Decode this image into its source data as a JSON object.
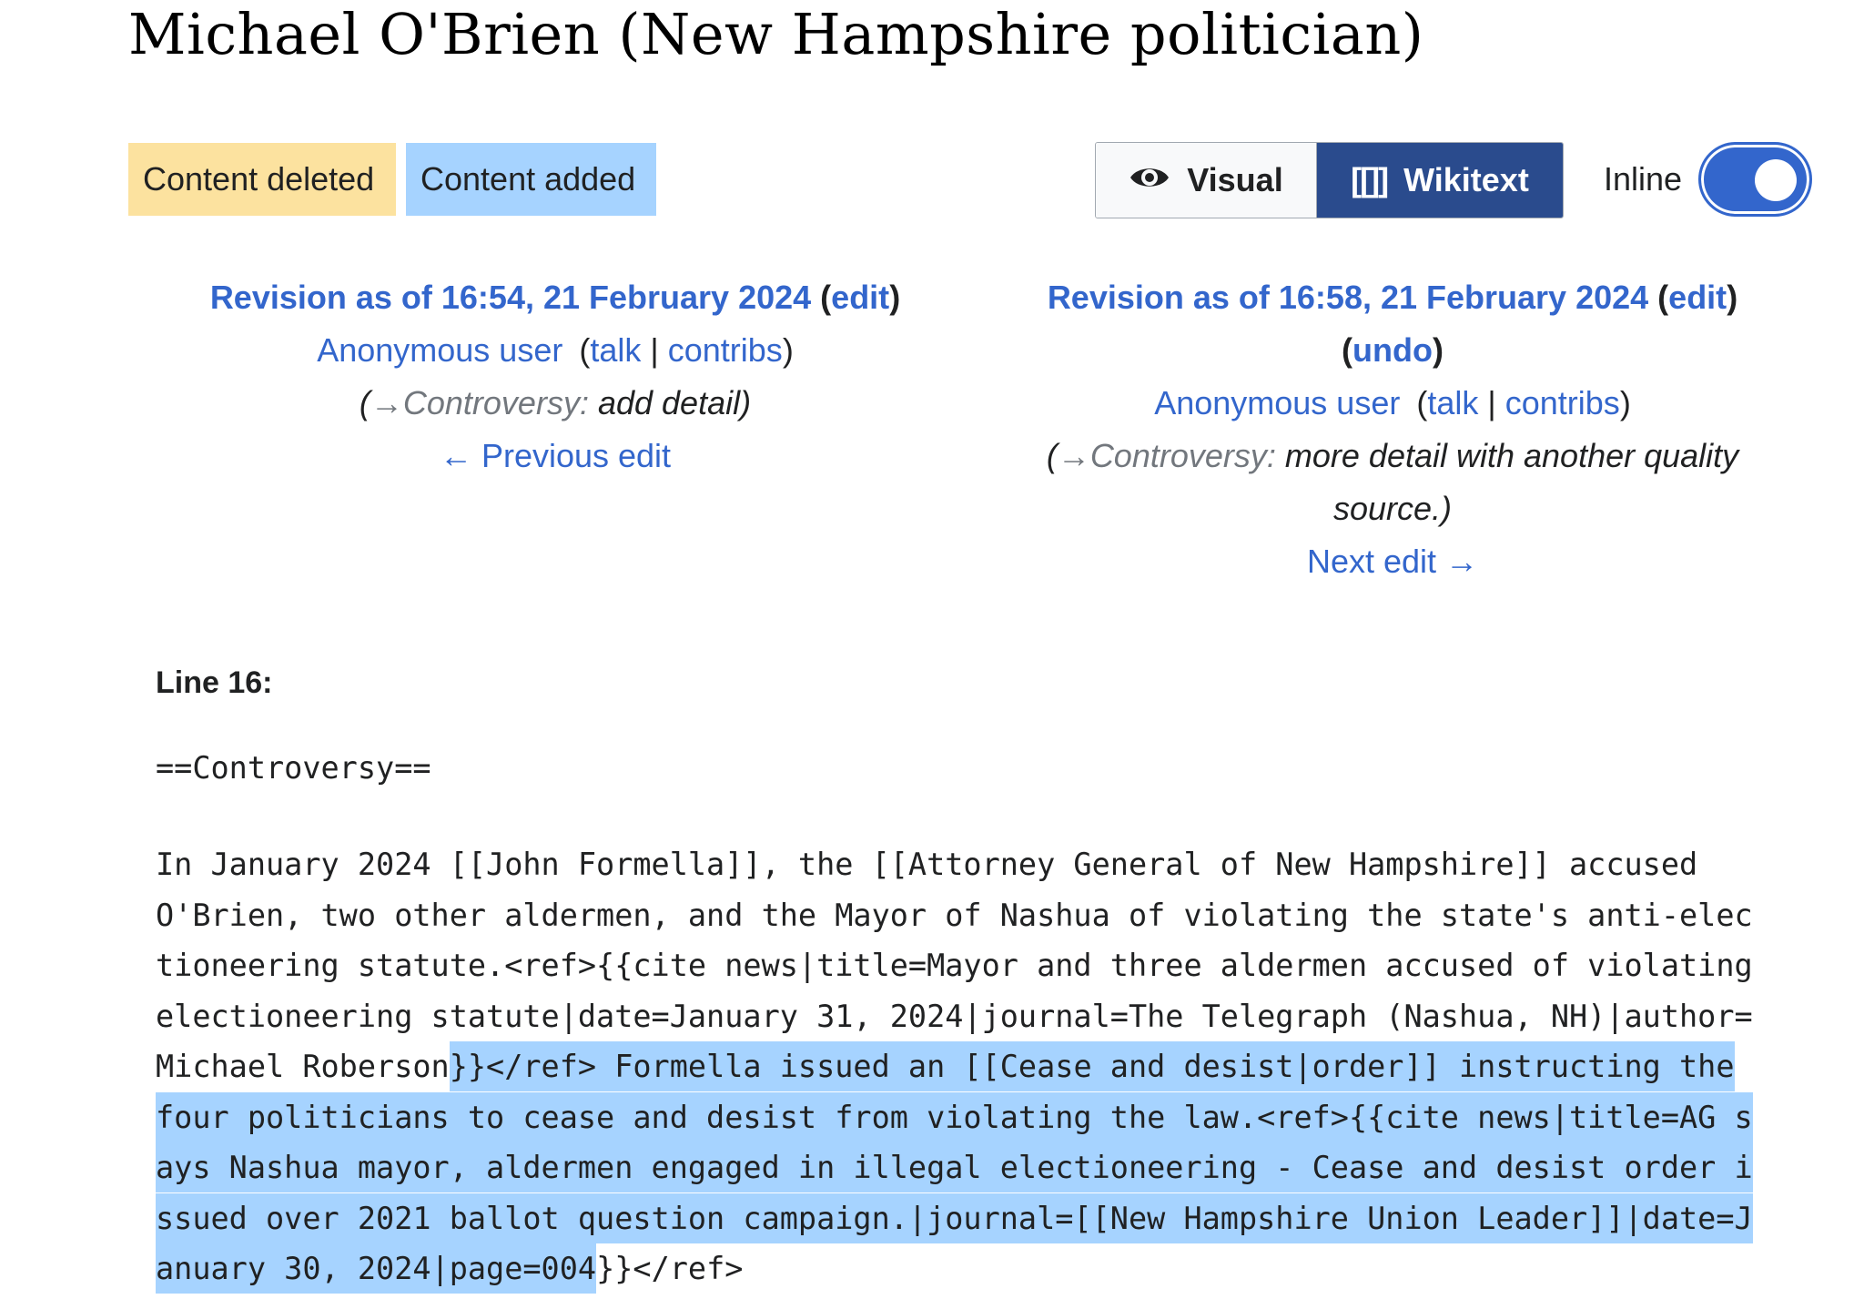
{
  "page": {
    "title": "Michael O'Brien (New Hampshire politician)"
  },
  "legend": {
    "deleted": "Content deleted",
    "added": "Content added"
  },
  "view_toggle": {
    "visual": "Visual",
    "wikitext_glyph": "[[]]",
    "wikitext": "Wikitext",
    "inline_label": "Inline",
    "inline_on": true
  },
  "left_revision": {
    "title": "Revision as of 16:54, 21 February 2024",
    "edit_open": "(",
    "edit": "edit",
    "edit_close": ")",
    "user": "Anonymous user",
    "talk": "talk",
    "sep": "|",
    "contribs": "contribs",
    "summary_section": "→Controversy:",
    "summary_text": "add detail",
    "prev_edit": "← Previous edit"
  },
  "right_revision": {
    "title": "Revision as of 16:58, 21 February 2024",
    "edit_open": "(",
    "edit": "edit",
    "edit_close": ")",
    "undo": "undo",
    "user": "Anonymous user",
    "talk": "talk",
    "sep": "|",
    "contribs": "contribs",
    "summary_section": "→Controversy:",
    "summary_text": "more detail with another quality source.",
    "next_edit": "Next edit →"
  },
  "diff": {
    "line_label": "Line 16:",
    "heading": "==Controversy==",
    "paragraph_unchanged": "In January 2024 [[John Formella]], the [[Attorney General of New Hampshire]] accused O'Brien, two other aldermen, and the Mayor of Nashua of violating the state's anti-electioneering statute.<ref>{{cite news|title=Mayor and three aldermen accused of violating electioneering statute|date=January 31, 2024|journal=The Telegraph (Nashua, NH)|author=Michael Roberson",
    "paragraph_added": "}}</ref> Formella issued an [[Cease and desist|order]] instructing the four politicians to cease and desist from violating the law.<ref>{{cite news|title=AG says Nashua mayor, aldermen engaged in illegal electioneering - Cease and desist order issued over 2021 ballot question campaign.|journal=[[New Hampshire Union Leader]]|date=January 30, 2024|page=004",
    "paragraph_tail": "}}</ref>"
  },
  "colors": {
    "deleted_bg": "#fce29f",
    "added_bg": "#a6d3ff",
    "link": "#3366cc",
    "wikitext_active_bg": "#2a4b8d",
    "switch_on": "#3366cc"
  }
}
